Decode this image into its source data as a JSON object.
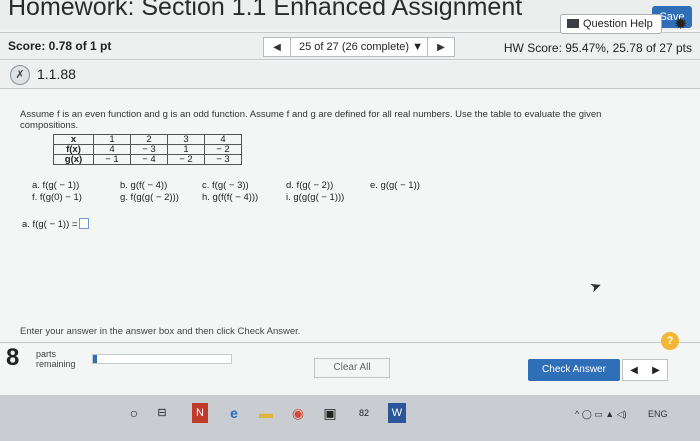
{
  "header": {
    "title": "Homework: Section 1.1 Enhanced Assignment",
    "save": "Save"
  },
  "scorebar": {
    "score": "Score: 0.78 of 1 pt",
    "question_selector": "25 of 27 (26 complete)",
    "hw_score": "HW Score: 95.47%, 25.78 of 27 pts"
  },
  "question": {
    "number": "1.1.88",
    "help": "Question Help",
    "statement": "Assume f is an even function and g is an odd function. Assume f and g are defined for all real numbers. Use the table to evaluate the given compositions.",
    "table": {
      "headers": [
        "x",
        "f(x)",
        "g(x)"
      ],
      "columns": [
        [
          "1",
          "4",
          "− 1"
        ],
        [
          "2",
          "− 3",
          "− 4"
        ],
        [
          "3",
          "1",
          "− 2"
        ],
        [
          "4",
          "− 2",
          "− 3"
        ]
      ]
    },
    "parts_row1": [
      "a. f(g( − 1))",
      "b. g(f( − 4))",
      "c. f(g( − 3))",
      "d. f(g( − 2))",
      "e. g(g( − 1))"
    ],
    "parts_row2": [
      "f. f(g(0) − 1)",
      "g. f(g(g( − 2)))",
      "h. g(f(f( − 4)))",
      "i. g(g(g( − 1)))"
    ],
    "answer_prompt": "a. f(g( − 1)) ="
  },
  "footer": {
    "instruction": "Enter your answer in the answer box and then click Check Answer.",
    "parts_count": "8",
    "parts_label1": "parts",
    "parts_label2": "remaining",
    "progress_fraction": 0.03,
    "clear": "Clear All",
    "check": "Check Answer"
  },
  "taskbar": {
    "badge": "82",
    "lang": "ENG"
  }
}
